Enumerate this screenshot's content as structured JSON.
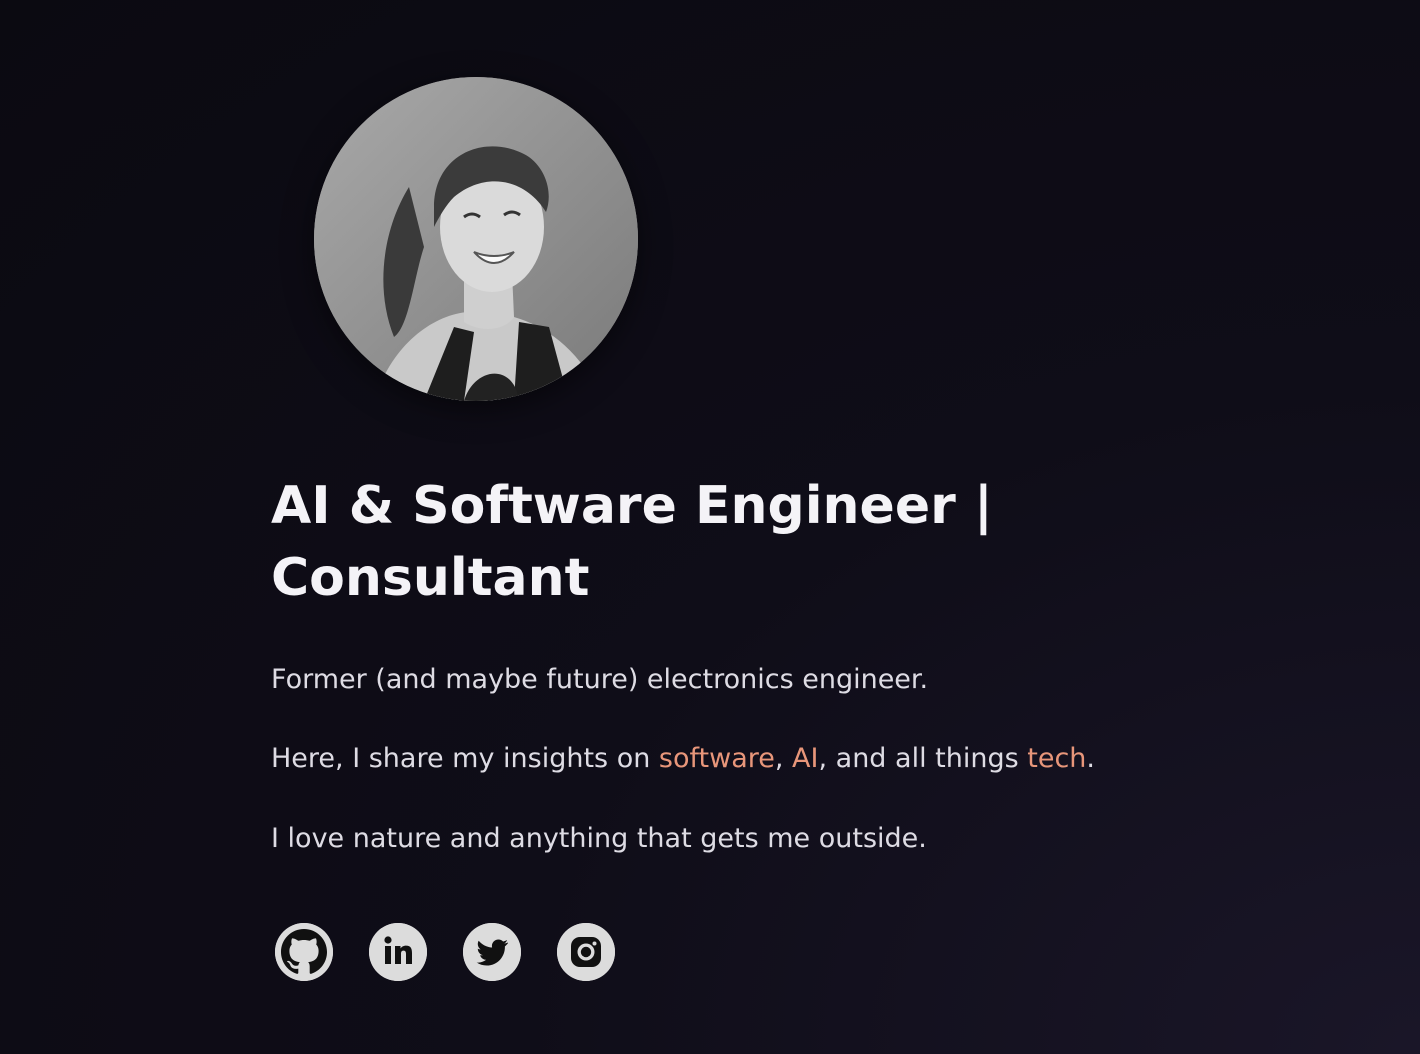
{
  "profile": {
    "avatar_icon": "profile-photo"
  },
  "headline": "AI & Software Engineer | Consultant",
  "about": {
    "line1": "Former (and maybe future) electronics engineer.",
    "line2_prefix": "Here, I share my insights on ",
    "line2_link1": "software",
    "line2_sep1": ", ",
    "line2_link2": "AI",
    "line2_sep2": ", and all things ",
    "line2_link3": "tech",
    "line2_suffix": ".",
    "line3": "I love nature and anything that gets me outside."
  },
  "socials": [
    {
      "icon": "github-icon"
    },
    {
      "icon": "linkedin-icon"
    },
    {
      "icon": "twitter-icon"
    },
    {
      "icon": "instagram-icon"
    }
  ],
  "colors": {
    "accent": "#e8967a",
    "background": "#0b0a11",
    "text": "#dedce4",
    "icon_bg": "#dcdcdc"
  }
}
